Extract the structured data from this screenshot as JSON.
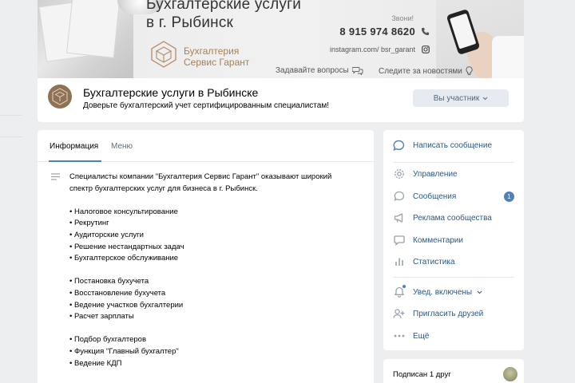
{
  "cover": {
    "title": "Бухгалтерские услуги\nв г. Рыбинск",
    "brand_line1": "Бухгалтерия",
    "brand_line2": "Сервис Гарант",
    "call_label": "Звони!",
    "phone": "8 915 974 8620",
    "instagram": "instagram.com/ bsr_garant",
    "ask_label": "Задавайте вопросы",
    "follow_label": "Следите за новостями"
  },
  "header": {
    "group_name": "Бухгалтерские услуги в Рыбинске",
    "status": "Доверьте бухгалтерский учет сертифицированным специалистам!",
    "member_button": "Вы участник"
  },
  "tabs": [
    {
      "label": "Информация",
      "active": true
    },
    {
      "label": "Меню",
      "active": false
    }
  ],
  "description": {
    "intro_1": "Специалисты компании \"Бухгалтерия Сервис Гарант\" оказывают широкий",
    "intro_2": "спектр бухгалтерских услуг для бизнеса в г. Рыбинск.",
    "group1": [
      "• Налоговое консультирование",
      "• Рекрутинг",
      "• Аудиторские услуги",
      "• Решение нестандартных задач",
      "• Бухгалтерское обслуживание"
    ],
    "group2": [
      "• Постановка бухучета",
      "• Восстановление бухучета",
      "• Ведение участков бухгалтерии",
      "• Расчет зарплаты"
    ],
    "group3": [
      "• Подбор бухгалтеров",
      "• Функция \"Главный бухгалтер\"",
      "• Ведение КДП"
    ]
  },
  "side_menu": {
    "write_message": "Написать сообщение",
    "items": [
      {
        "label": "Управление",
        "icon": "gear-icon"
      },
      {
        "label": "Сообщения",
        "icon": "message-icon",
        "badge": "1"
      },
      {
        "label": "Реклама сообщества",
        "icon": "megaphone-icon"
      },
      {
        "label": "Комментарии",
        "icon": "comment-icon"
      },
      {
        "label": "Статистика",
        "icon": "stats-icon"
      }
    ],
    "notifications": "Увед. включены",
    "invite": "Пригласить друзей",
    "more": "Ещё"
  },
  "friends": {
    "label": "Подписан 1 друг"
  },
  "colors": {
    "accent": "#5181b8",
    "link": "#2a5885",
    "page_bg": "#edeef0",
    "brand_gold": "#a6805a"
  }
}
